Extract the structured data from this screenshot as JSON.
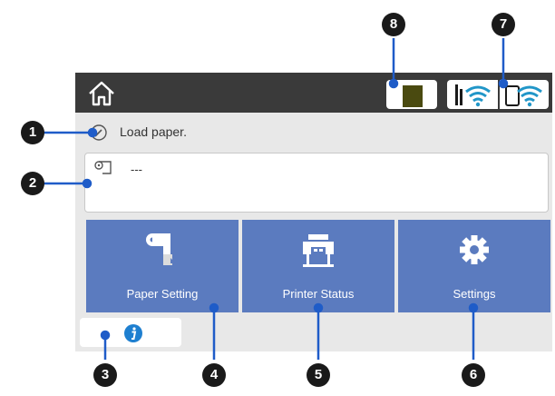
{
  "callouts": [
    "1",
    "2",
    "3",
    "4",
    "5",
    "6",
    "7",
    "8"
  ],
  "status": {
    "message": "Load paper."
  },
  "paper_info": {
    "value": "---"
  },
  "tiles": [
    {
      "label": "Paper Setting"
    },
    {
      "label": "Printer Status"
    },
    {
      "label": "Settings"
    }
  ],
  "colors": {
    "tile": "#5b7bbf",
    "callout_line": "#1f5cc8",
    "topbar": "#3a3a3a",
    "wifi": "#2196c8",
    "info": "#1e7fd0",
    "ink": "#4a4a10"
  },
  "icons": [
    "home-icon",
    "ink-level-icon",
    "wifi-icon",
    "wifi-direct-icon",
    "edit-circle-icon",
    "roll-paper-icon",
    "paper-setting-icon",
    "printer-icon",
    "gear-icon",
    "info-icon"
  ]
}
